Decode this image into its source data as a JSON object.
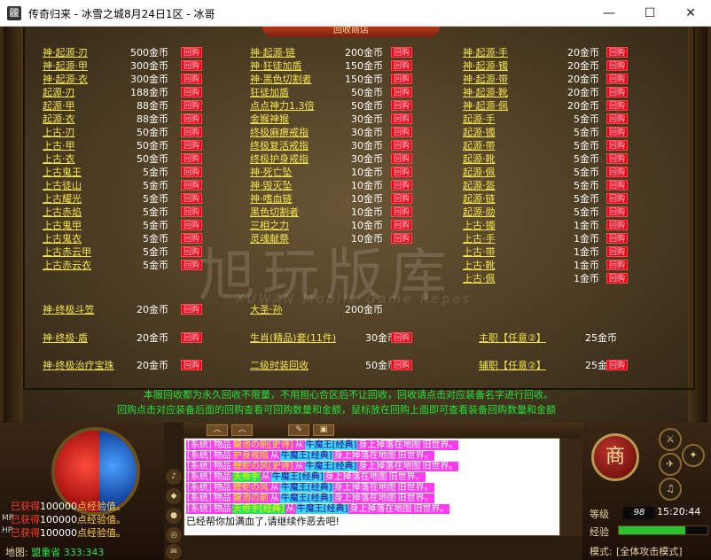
{
  "window": {
    "title": "传奇归来 - 冰雪之城8月24日1区 - 冰哥",
    "icon_glyph": "龖",
    "min_glyph": "—",
    "max_glyph": "☐",
    "close_glyph": "✕"
  },
  "panel": {
    "tab_title": "回收商店",
    "buy_label": "回购",
    "columns": [
      {
        "items": [
          {
            "name": "神·起源·刃",
            "price": "500金币"
          },
          {
            "name": "神·起源·甲",
            "price": "300金币"
          },
          {
            "name": "神·起源·衣",
            "price": "300金币"
          },
          {
            "name": "起源·刃",
            "price": "188金币"
          },
          {
            "name": "起源·甲",
            "price": "88金币"
          },
          {
            "name": "起源·衣",
            "price": "88金币"
          },
          {
            "name": "上古·刃",
            "price": "50金币"
          },
          {
            "name": "上古·甲",
            "price": "50金币"
          },
          {
            "name": "上古·衣",
            "price": "50金币"
          },
          {
            "name": "上古鬼王",
            "price": "5金币"
          },
          {
            "name": "上古徒山",
            "price": "5金币"
          },
          {
            "name": "上古耀光",
            "price": "5金币"
          },
          {
            "name": "上古赤焰",
            "price": "5金币"
          },
          {
            "name": "上古鬼甲",
            "price": "5金币"
          },
          {
            "name": "上古鬼衣",
            "price": "5金币"
          },
          {
            "name": "上古赤云甲",
            "price": "5金币"
          },
          {
            "name": "上古赤云衣",
            "price": "5金币"
          }
        ]
      },
      {
        "items": [
          {
            "name": "神·起源·链",
            "price": "200金币"
          },
          {
            "name": "神·狂徒加盾",
            "price": "150金币"
          },
          {
            "name": "神·黑色切割者",
            "price": "150金币"
          },
          {
            "name": "狂徒加盾",
            "price": "50金币"
          },
          {
            "name": "点点神力1.3倍",
            "price": "50金币"
          },
          {
            "name": "金猴神猴",
            "price": "30金币"
          },
          {
            "name": "终极麻痹戒指",
            "price": "30金币"
          },
          {
            "name": "终极复活戒指",
            "price": "30金币"
          },
          {
            "name": "终极护身戒指",
            "price": "30金币"
          },
          {
            "name": "神·死亡坠",
            "price": "10金币"
          },
          {
            "name": "神·毁灭坠",
            "price": "10金币"
          },
          {
            "name": "神·嗜血链",
            "price": "10金币"
          },
          {
            "name": "黑色切割者",
            "price": "10金币"
          },
          {
            "name": "三相之力",
            "price": "10金币"
          },
          {
            "name": "灵魂献祭",
            "price": "10金币"
          }
        ]
      },
      {
        "items": [
          {
            "name": "神·起源·手",
            "price": "20金币"
          },
          {
            "name": "神·起源·镯",
            "price": "20金币"
          },
          {
            "name": "神·起源·带",
            "price": "20金币"
          },
          {
            "name": "神·起源·靴",
            "price": "20金币"
          },
          {
            "name": "神·起源·佩",
            "price": "20金币"
          },
          {
            "name": "起源·手",
            "price": "5金币"
          },
          {
            "name": "起源·镯",
            "price": "5金币"
          },
          {
            "name": "起源·带",
            "price": "5金币"
          },
          {
            "name": "起源·靴",
            "price": "5金币"
          },
          {
            "name": "起源·佩",
            "price": "5金币"
          },
          {
            "name": "起源·盔",
            "price": "5金币"
          },
          {
            "name": "起源·链",
            "price": "5金币"
          },
          {
            "name": "起源·勋",
            "price": "5金币"
          },
          {
            "name": "上古·镯",
            "price": "1金币"
          },
          {
            "name": "上古·手",
            "price": "1金币"
          },
          {
            "name": "上古·带",
            "price": "1金币"
          },
          {
            "name": "上古·靴",
            "price": "1金币"
          },
          {
            "name": "上古·佩",
            "price": "1金币"
          }
        ]
      }
    ],
    "extra": [
      {
        "name": "神·终极斗笠",
        "price": "20金币"
      },
      {
        "name": "大圣·孙",
        "price": "200金币"
      },
      {
        "name": "神·终极·盾",
        "price": "20金币"
      },
      {
        "name": "生肖(精品)套(11件)",
        "price": "30金币"
      },
      {
        "name": "主职【任意②】",
        "price": "25金币"
      },
      {
        "name": "神·终极治疗宝珠",
        "price": "20金币"
      },
      {
        "name": "二级时装回收",
        "price": "50金币"
      },
      {
        "name": "辅职【任意②】",
        "price": "25金币"
      }
    ],
    "notice1": "本服回收都为永久回收不限量，不用担心合区后不让回收，回收请点击对应装备名字进行回收。",
    "notice2": "回购点击对应装备后面的回购查看可回购数量和金额，鼠标放在回购上面即可查看装备回购数量和金额",
    "watermark": "旭玩版库",
    "watermark_sub": "XUWAN Mobile Game Repos"
  },
  "hud": {
    "exp_lines": [
      {
        "a": "已获得",
        "b": "100000",
        "c": "点经验值。"
      },
      {
        "a": "已获得",
        "b": "100000",
        "c": "点经验值。"
      },
      {
        "a": "已获得",
        "b": "100000",
        "c": "点经验值。"
      }
    ],
    "mp_label": "MP",
    "hp_label": "HP",
    "map_label": "地图:",
    "map_value": "盟重省 333:343",
    "side_buttons": [
      "♪",
      "◆",
      "●",
      "◎",
      "✉",
      "⚙"
    ],
    "toolbar_buttons": [
      "︿",
      "︿",
      "✎",
      "▣"
    ],
    "chat_lines": [
      [
        {
          "t": "[系统]",
          "c": "c-mag"
        },
        {
          "t": "物品",
          "c": "c-mag"
        },
        {
          "t": "龍池の劍[史诗]",
          "c": "c-yel"
        },
        {
          "t": "从",
          "c": "c-mag"
        },
        {
          "t": "牛魔王[经典]",
          "c": "c-cya"
        },
        {
          "t": "身上掉落在地图",
          "c": "c-mag"
        },
        {
          "t": "旧世界。",
          "c": "c-mag"
        }
      ],
      [
        {
          "t": "[系统]",
          "c": "c-mag"
        },
        {
          "t": "物品",
          "c": "c-mag"
        },
        {
          "t": "护身戒指",
          "c": "c-yel"
        },
        {
          "t": "从",
          "c": "c-mag"
        },
        {
          "t": "牛魔王[经典]",
          "c": "c-cya"
        },
        {
          "t": "身上掉落在地图",
          "c": "c-mag"
        },
        {
          "t": "旧世界。",
          "c": "c-mag"
        }
      ],
      [
        {
          "t": "[系统]",
          "c": "c-mag"
        },
        {
          "t": "物品",
          "c": "c-mag"
        },
        {
          "t": "蝰蛇の风[史诗]",
          "c": "c-yel"
        },
        {
          "t": "从",
          "c": "c-mag"
        },
        {
          "t": "牛魔王[经典]",
          "c": "c-cya"
        },
        {
          "t": "身上掉落在地图",
          "c": "c-mag"
        },
        {
          "t": "旧世界。",
          "c": "c-mag"
        }
      ],
      [
        {
          "t": "[系统]",
          "c": "c-mag"
        },
        {
          "t": "物品",
          "c": "c-mag"
        },
        {
          "t": "天帝手",
          "c": "c-grn"
        },
        {
          "t": "从",
          "c": "c-mag"
        },
        {
          "t": "牛魔王[经典]",
          "c": "c-cya"
        },
        {
          "t": "身上掉落在地图",
          "c": "c-mag"
        },
        {
          "t": "旧世界。",
          "c": "c-mag"
        }
      ],
      [
        {
          "t": "[系统]",
          "c": "c-mag"
        },
        {
          "t": "物品",
          "c": "c-mag"
        },
        {
          "t": "蝰蛇の风",
          "c": "c-yel"
        },
        {
          "t": "从",
          "c": "c-mag"
        },
        {
          "t": "牛魔王[经典]",
          "c": "c-cya"
        },
        {
          "t": "身上掉落在地图",
          "c": "c-mag"
        },
        {
          "t": "旧世界。",
          "c": "c-mag"
        }
      ],
      [
        {
          "t": "[系统]",
          "c": "c-mag"
        },
        {
          "t": "物品",
          "c": "c-mag"
        },
        {
          "t": "龍池の劍",
          "c": "c-yel"
        },
        {
          "t": "从",
          "c": "c-mag"
        },
        {
          "t": "牛魔王[经典]",
          "c": "c-cya"
        },
        {
          "t": "身上掉落在地图",
          "c": "c-mag"
        },
        {
          "t": "旧世界。",
          "c": "c-mag"
        }
      ],
      [
        {
          "t": "[系统]",
          "c": "c-mag"
        },
        {
          "t": "物品",
          "c": "c-mag"
        },
        {
          "t": "天帝手[经典]",
          "c": "c-grn"
        },
        {
          "t": "从",
          "c": "c-mag"
        },
        {
          "t": "牛魔王[经典]",
          "c": "c-cya"
        },
        {
          "t": "身上掉落在地图",
          "c": "c-mag"
        },
        {
          "t": "旧世界。",
          "c": "c-mag"
        }
      ]
    ],
    "chat_last": "已经帮你加满血了,请继续作恶去吧!",
    "shop_label": "商",
    "right_buttons": [
      "⚔",
      "✦",
      "✈",
      "♫"
    ],
    "level_label": "等级",
    "level_value": "98",
    "time_value": "15:20:44",
    "exp_label": "经验",
    "exp_fraction": 0.75,
    "mode_label": "模式:",
    "mode_value": "[全体攻击模式]"
  }
}
